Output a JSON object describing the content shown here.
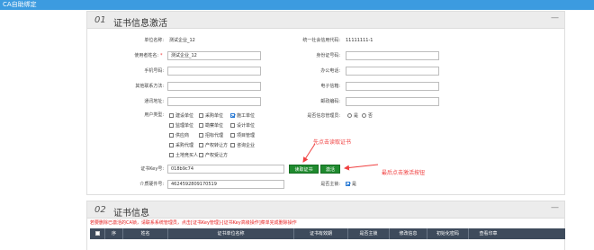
{
  "window": {
    "title": "CA自助绑定"
  },
  "section1": {
    "number": "01",
    "title": "证书信息激活",
    "collapse": "—",
    "fields": {
      "company_name_label": "单位名称:",
      "company_name_value": "测试企业_12",
      "credit_code_label": "统一社会信用代码:",
      "credit_code_value": "11111111-1",
      "user_name_label": "使用者姓名:",
      "user_name_required": "*",
      "user_name_value": "测试企业_12",
      "id_card_label": "身份证号码:",
      "mobile_label": "手机号码:",
      "office_phone_label": "办公电话:",
      "other_contact_label": "其他联系方法:",
      "email_label": "电子信箱:",
      "address_label": "通讯地址:",
      "postcode_label": "邮政编码:",
      "user_type_label": "用户类型:",
      "info_admin_label": "是否信息管理员:",
      "cert_key_label": "证书Key号:",
      "cert_key_value": "018b9c74",
      "media_id_label": "介质硬件号:",
      "media_id_value": "4624592809170519",
      "is_master_label": "是否主锁:",
      "is_master_value": "是"
    },
    "user_types": [
      {
        "label": "建设单位",
        "checked": false
      },
      {
        "label": "采购单位",
        "checked": false
      },
      {
        "label": "施工单位",
        "checked": true
      },
      {
        "label": "监理单位",
        "checked": false
      },
      {
        "label": "勘察单位",
        "checked": false
      },
      {
        "label": "设计单位",
        "checked": false
      },
      {
        "label": "供应商",
        "checked": false
      },
      {
        "label": "招标代理",
        "checked": false
      },
      {
        "label": "项目管理",
        "checked": false
      },
      {
        "label": "采购代理",
        "checked": false
      },
      {
        "label": "产权转让方",
        "checked": false
      },
      {
        "label": "咨询企业",
        "checked": false
      },
      {
        "label": "土地竞买人",
        "checked": false
      },
      {
        "label": "产权受让方",
        "checked": false
      }
    ],
    "admin_options": {
      "yes": "是",
      "no": "否"
    },
    "buttons": {
      "read_cert": "读取证书",
      "activate": "激活"
    },
    "annotations": {
      "first": "先点击读取证书",
      "last": "最后点击激活按钮"
    }
  },
  "section2": {
    "number": "02",
    "title": "证书信息",
    "collapse": "—",
    "warning": "若要删除已激活的CA锁，请联系系统管理员，点击[证书Key管理]-[证书Key高级操作]菜单完成删除操作",
    "columns": [
      "序",
      "姓名",
      "证书单位名称",
      "证书有效期",
      "是否主锁",
      "修改信息",
      "初始化密码",
      "查看印章"
    ]
  },
  "colors": {
    "topbar": "#3c9be0",
    "button": "#1f8a2e",
    "annotation": "#f04040",
    "table_header": "#3e4b5c"
  }
}
